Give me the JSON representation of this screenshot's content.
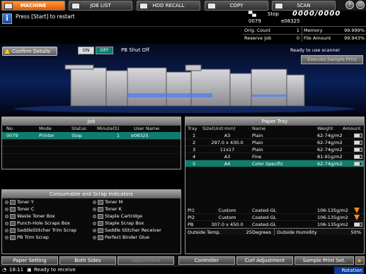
{
  "tabs": [
    {
      "label": "MACHINE",
      "icon": "printer-icon"
    },
    {
      "label": "JOB LIST",
      "icon": "list-icon"
    },
    {
      "label": "HDD RECALL",
      "icon": "hdd-icon"
    },
    {
      "label": "COPY",
      "icon": "copy-icon"
    },
    {
      "label": "SCAN",
      "icon": "scan-icon"
    }
  ],
  "message": {
    "text": "Press [Start] to restart"
  },
  "status": {
    "label": "Stop",
    "count": "0000/0000",
    "job_no": "0079",
    "user": "e08325",
    "orig_count_label": "Orig. Count",
    "orig_count": "1",
    "memory_label": "Memory",
    "memory": "99.999%",
    "reserve_job_label": "Reserve Job",
    "reserve_job": "0",
    "file_amount_label": "File Amount",
    "file_amount": "99.943%"
  },
  "machine": {
    "confirm_details": "Confirm Details",
    "on_label": "ON",
    "off_label": "OFF",
    "pb_shut_off": "PB Shut Off",
    "scanner_status": "Ready to use scanner",
    "execute_sample_print": "Execute Sample Print"
  },
  "job": {
    "title": "Job",
    "headers": [
      "No.",
      "Mode",
      "Status",
      "Minute(S)",
      "User Name"
    ],
    "rows": [
      {
        "no": "0079",
        "mode": "Printer",
        "status": "Stop",
        "minute": "1",
        "user": "e08325"
      }
    ]
  },
  "consumables": {
    "title": "Consumable and Scrap Indicators",
    "items": [
      "Toner Y",
      "Toner M",
      "Toner C",
      "Toner K",
      "Waste Toner Box",
      "Staple Cartridge",
      "Punch-Hole Scraps Box",
      "Staple Scrap Box",
      "SaddleStitcher Trim Scrap",
      "Saddle Stitcher Receiver",
      "PB Trim Scrap",
      "Perfect Binder Glue"
    ]
  },
  "paper_tray": {
    "title": "Paper Tray",
    "headers": [
      "Tray",
      "Size(Unit:mm)",
      "Name",
      "Weight",
      "Amount"
    ],
    "rows": [
      {
        "tray": "1",
        "size": "A3",
        "name": "Plain",
        "weight": "62-74g/m2"
      },
      {
        "tray": "2",
        "size": "297.0 x 430.0",
        "name": "Plain",
        "weight": "62-74g/m2"
      },
      {
        "tray": "3",
        "size": "11x17",
        "name": "Plain",
        "weight": "62-74g/m2"
      },
      {
        "tray": "4",
        "size": "A3",
        "name": "Fine",
        "weight": "81-91g/m2"
      },
      {
        "tray": "5",
        "size": "A4",
        "name": "Color Specific",
        "weight": "62-74g/m2"
      }
    ],
    "pi_rows": [
      {
        "tray": "PI1",
        "size": "Custom",
        "name": "Coated-GL",
        "weight": "106-135g/m2"
      },
      {
        "tray": "PI2",
        "size": "Custom",
        "name": "Coated-GL",
        "weight": "106-135g/m2"
      },
      {
        "tray": "PB",
        "size": "307.0 x 450.0",
        "name": "Coated-GL",
        "weight": "106-135g/m2"
      }
    ],
    "outside_temp_label": "Outside Temp.",
    "outside_temp": "25Degrees",
    "outside_humidity_label": "Outside Humidity",
    "outside_humidity": "50%"
  },
  "bottom_buttons": [
    "Paper Setting",
    "Both Sides",
    "Adjustment",
    "Controller",
    "Curl Adjustment",
    "Sample Print Set."
  ],
  "footer": {
    "time": "18:11",
    "status": "Ready to receive",
    "rotation": "Rotation"
  }
}
